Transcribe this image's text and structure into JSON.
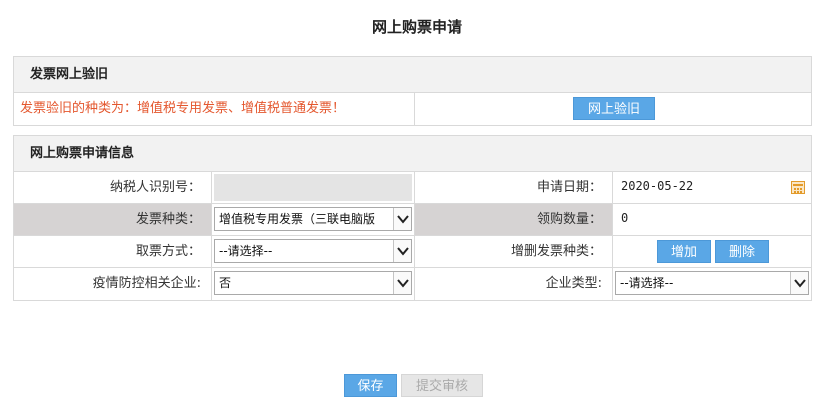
{
  "page_title": "网上购票申请",
  "verify_section": {
    "header": "发票网上验旧",
    "notice": "发票验旧的种类为：增值税专用发票、增值税普通发票！",
    "verify_button": "网上验旧"
  },
  "apply_section": {
    "header": "网上购票申请信息",
    "taxpayer_id_label": "纳税人识别号：",
    "taxpayer_id_value": "",
    "apply_date_label": "申请日期：",
    "apply_date_value": "2020-05-22",
    "invoice_type_label": "发票种类：",
    "invoice_type_value": "增值税专用发票（三联电脑版",
    "quantity_label": "领购数量：",
    "quantity_value": "0",
    "pickup_method_label": "取票方式：",
    "pickup_method_value": "--请选择--",
    "add_remove_label": "增删发票种类：",
    "add_button": "增加",
    "delete_button": "删除",
    "epidemic_label": "疫情防控相关企业:",
    "epidemic_value": "否",
    "company_type_label": "企业类型:",
    "company_type_value": "--请选择--"
  },
  "footer": {
    "save_button": "保存",
    "submit_button": "提交审核"
  },
  "colors": {
    "accent_button": "#5aa7e6",
    "warning_text": "#e4572e",
    "shaded_label": "#d6d3d3"
  }
}
